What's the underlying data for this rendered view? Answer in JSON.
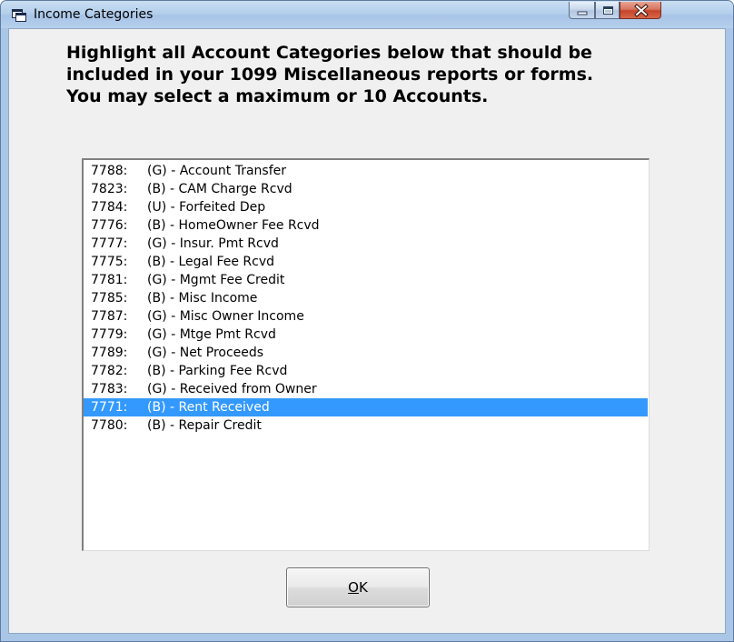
{
  "window": {
    "title": "Income Categories",
    "icons": {
      "app": "app-window-icon",
      "minimize": "minimize-icon",
      "maximize": "maximize-icon",
      "close": "close-icon"
    }
  },
  "instructions": {
    "line1": "Highlight all Account Categories below that should be",
    "line2": "included in your 1099 Miscellaneous reports or forms.",
    "line3": "You may select a maximum or 10 Accounts."
  },
  "list": {
    "items": [
      {
        "code": "7788:",
        "desc": "(G) - Account Transfer",
        "selected": false
      },
      {
        "code": "7823:",
        "desc": "(B) - CAM Charge Rcvd",
        "selected": false
      },
      {
        "code": "7784:",
        "desc": "(U) - Forfeited Dep",
        "selected": false
      },
      {
        "code": "7776:",
        "desc": "(B) - HomeOwner Fee Rcvd",
        "selected": false
      },
      {
        "code": "7777:",
        "desc": "(G) - Insur. Pmt Rcvd",
        "selected": false
      },
      {
        "code": "7775:",
        "desc": "(B) - Legal Fee Rcvd",
        "selected": false
      },
      {
        "code": "7781:",
        "desc": "(G) - Mgmt Fee Credit",
        "selected": false
      },
      {
        "code": "7785:",
        "desc": "(B) - Misc Income",
        "selected": false
      },
      {
        "code": "7787:",
        "desc": "(G) - Misc Owner Income",
        "selected": false
      },
      {
        "code": "7779:",
        "desc": "(G) - Mtge Pmt Rcvd",
        "selected": false
      },
      {
        "code": "7789:",
        "desc": "(G) - Net Proceeds",
        "selected": false
      },
      {
        "code": "7782:",
        "desc": "(B) - Parking Fee Rcvd",
        "selected": false
      },
      {
        "code": "7783:",
        "desc": "(G) - Received from Owner",
        "selected": false
      },
      {
        "code": "7771:",
        "desc": "(B) - Rent Received",
        "selected": true
      },
      {
        "code": "7780:",
        "desc": "(B) - Repair Credit",
        "selected": false
      }
    ]
  },
  "buttons": {
    "ok_mnemonic": "O",
    "ok_rest": "K"
  },
  "colors": {
    "selection": "#3399ff",
    "dialog_bg": "#f0f0f0",
    "close_button": "#c5442a"
  }
}
